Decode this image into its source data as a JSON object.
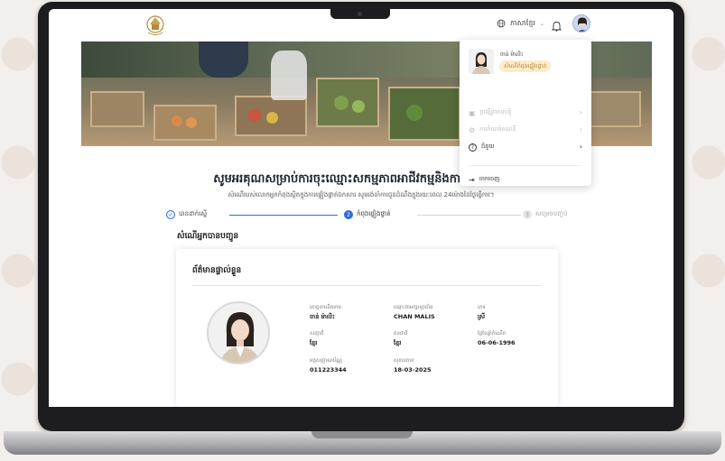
{
  "header": {
    "language_label": "ភាសាខ្មែរ"
  },
  "page": {
    "title": "សូមអរគុណសម្រាប់ការចុះឈ្មោះសកម្មភាពអាជីវកម្មនិងការងារនៅលេ",
    "subtitle": "សំណើរបស់លោកអ្នកកំពុងស្ថិតក្នុងការផ្ទៀងផ្ទាត់ឯកសារ សូមរង់ចាំការជូនដំណឹងក្នុងរយៈពេល 24ម៉ោងនៃថ្ងៃធ្វើការ។"
  },
  "stepper": {
    "steps": [
      {
        "label": "បានដាក់ស្នើ",
        "number": "✓",
        "state": "done"
      },
      {
        "label": "កំពុងផ្ទៀងផ្ទាត់",
        "number": "2",
        "state": "active"
      },
      {
        "label": "សម្រេចបញ្ចប់",
        "number": "3",
        "state": "pending"
      }
    ]
  },
  "section": {
    "title": "សំណើអ្នកបានបញ្ជូន"
  },
  "card": {
    "title": "ព័ត៌មានផ្ទាល់ខ្លួន",
    "fields": [
      {
        "label": "គោត្តនាមនិងនាម",
        "value": "ចាន់ ម៉ាលិះ"
      },
      {
        "label": "ឈ្មោះជាអក្សរឡាតាំង",
        "value": "CHAN MALIS"
      },
      {
        "label": "ភេទ",
        "value": "ស្រី"
      },
      {
        "label": "សញ្ជាតិ",
        "value": "ខ្មែរ"
      },
      {
        "label": "ជនជាតិ",
        "value": "ខ្មែរ"
      },
      {
        "label": "ថ្ងៃខែឆ្នាំកំណើត",
        "value": "06-06-1996"
      },
      {
        "label": "អត្តសញ្ញាណប័ណ្ណ",
        "value": "011223344"
      },
      {
        "label": "សុពលភាព",
        "value": "18-03-2025"
      }
    ]
  },
  "dropdown": {
    "name": "ចាន់ ម៉ាលិះ",
    "badge": "សំណើកំពុងផ្ទៀងផ្ទាត់",
    "items": [
      {
        "label": "ប្រវត្តិរូបរបស់ខ្ញុំ",
        "disabled": true
      },
      {
        "label": "ការកំណត់គណនី",
        "disabled": true
      },
      {
        "label": "ជំនួយ",
        "disabled": false
      }
    ],
    "logout": "ចាកចេញ"
  },
  "colors": {
    "accent": "#2d6cdf",
    "badge_bg": "#fbeccb",
    "badge_text": "#b6822b"
  }
}
